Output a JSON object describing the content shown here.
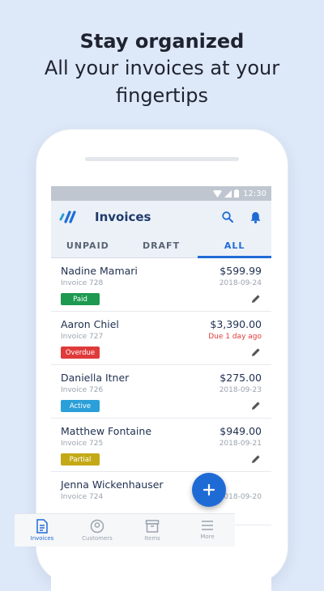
{
  "headline": {
    "title": "Stay organized",
    "subtitle_line1": "All your invoices at your",
    "subtitle_line2": "fingertips"
  },
  "status_bar": {
    "time": "12:30"
  },
  "app_bar": {
    "title": "Invoices",
    "logo_icon": "wave-logo",
    "search_icon": "search-icon",
    "notification_icon": "bell-icon"
  },
  "tabs": [
    {
      "label": "UNPAID",
      "active": false
    },
    {
      "label": "DRAFT",
      "active": false
    },
    {
      "label": "ALL",
      "active": true
    }
  ],
  "invoices": [
    {
      "name": "Nadine Mamari",
      "number": "Invoice 728",
      "amount": "$599.99",
      "date": "2018-09-24",
      "status": "Paid",
      "status_color": "#1d9a50"
    },
    {
      "name": "Aaron Chiel",
      "number": "Invoice 727",
      "amount": "$3,390.00",
      "date": "Due 1 day ago",
      "status": "Overdue",
      "status_color": "#e03a3a"
    },
    {
      "name": "Daniella Itner",
      "number": "Invoice 726",
      "amount": "$275.00",
      "date": "2018-09-23",
      "status": "Active",
      "status_color": "#2a9fd8"
    },
    {
      "name": "Matthew Fontaine",
      "number": "Invoice 725",
      "amount": "$949.00",
      "date": "2018-09-21",
      "status": "Partial",
      "status_color": "#c4a916"
    },
    {
      "name": "Jenna Wickenhauser",
      "number": "Invoice 724",
      "amount": "",
      "date": "2018-09-20",
      "status": "",
      "status_color": ""
    }
  ],
  "fab": {
    "icon": "plus-icon"
  },
  "bottom_nav": [
    {
      "label": "Invoices",
      "icon": "invoice-icon",
      "active": true
    },
    {
      "label": "Customers",
      "icon": "customer-icon",
      "active": false
    },
    {
      "label": "Items",
      "icon": "box-icon",
      "active": false
    },
    {
      "label": "More",
      "icon": "menu-icon",
      "active": false
    }
  ],
  "colors": {
    "accent": "#1f6bd6",
    "background": "#dde8f8",
    "appbar": "#ecf1f8"
  }
}
